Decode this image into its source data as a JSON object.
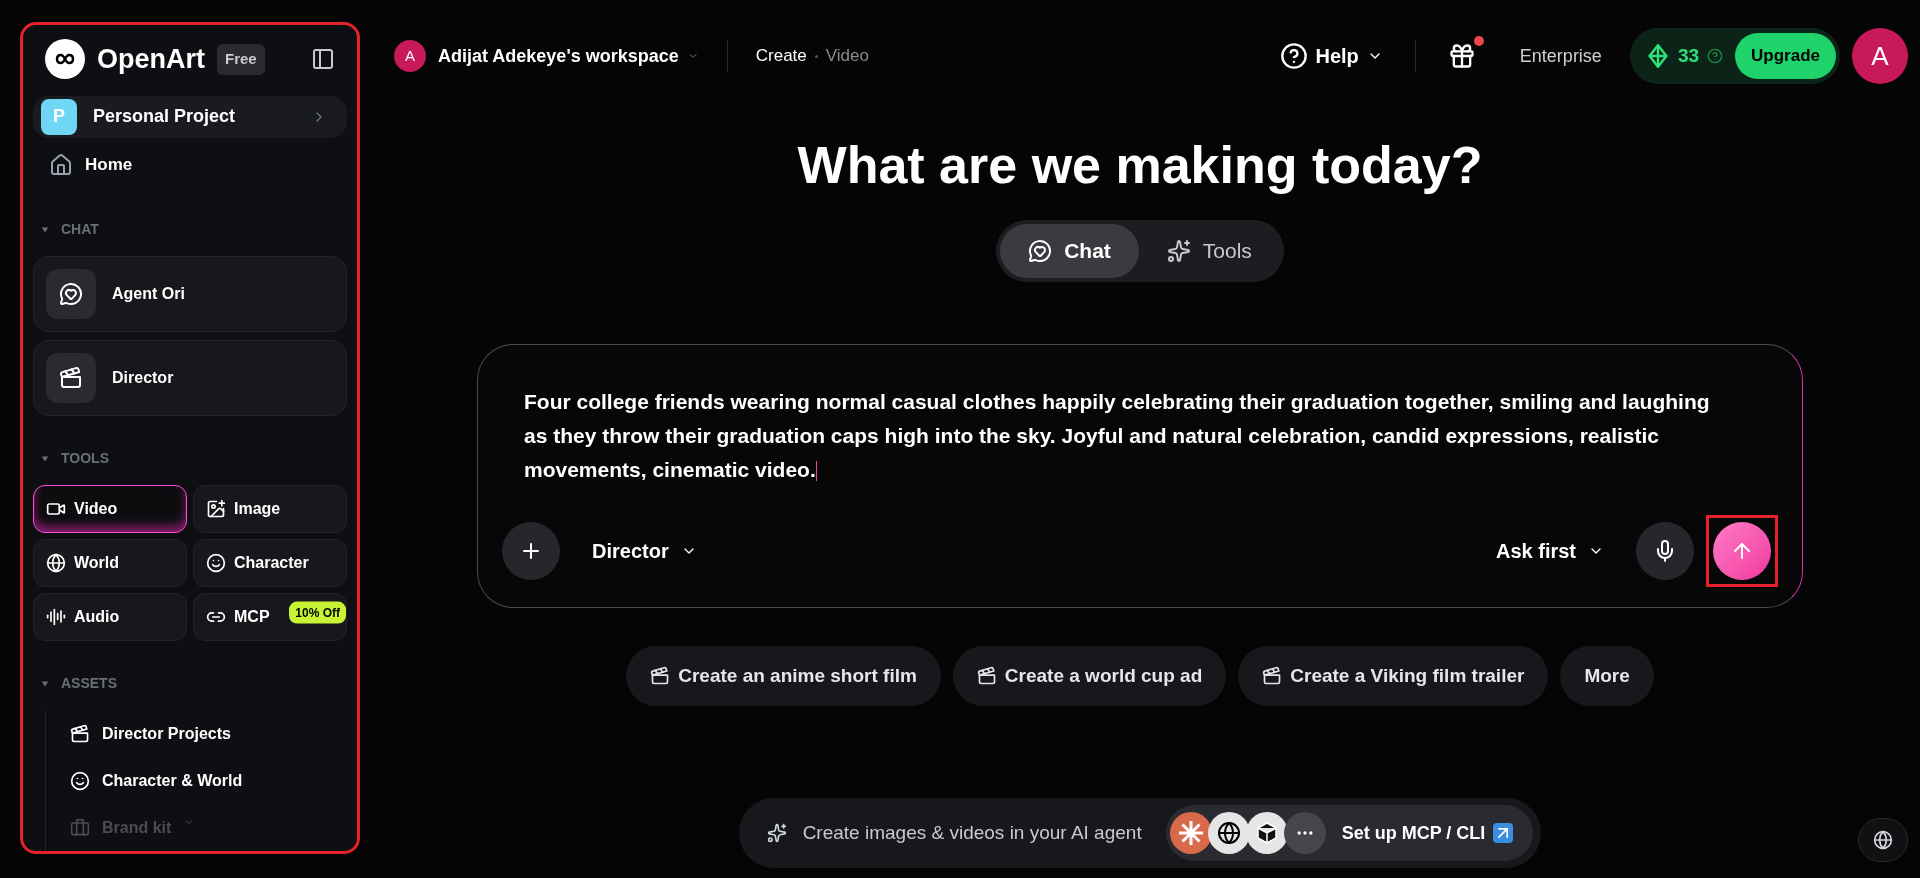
{
  "sidebar": {
    "highlighted": true,
    "brand": "OpenArt",
    "plan_badge": "Free",
    "project": {
      "initial": "P",
      "name": "Personal Project"
    },
    "home": "Home",
    "sections": [
      {
        "title": "CHAT",
        "expanded": true,
        "kind": "cards",
        "items": [
          {
            "label": "Agent Ori"
          },
          {
            "label": "Director"
          }
        ]
      },
      {
        "title": "TOOLS",
        "expanded": true,
        "kind": "grid",
        "items": [
          {
            "label": "Video",
            "selected": true
          },
          {
            "label": "Image",
            "selected": false
          },
          {
            "label": "World",
            "selected": false
          },
          {
            "label": "Character",
            "selected": false
          },
          {
            "label": "Audio",
            "selected": false
          },
          {
            "label": "MCP",
            "selected": false,
            "badge": "10% Off"
          }
        ]
      },
      {
        "title": "ASSETS",
        "expanded": true,
        "kind": "list",
        "items": [
          {
            "label": "Director Projects",
            "disabled": false
          },
          {
            "label": "Character & World",
            "disabled": false
          },
          {
            "label": "Brand kit",
            "disabled": true
          }
        ]
      }
    ]
  },
  "header": {
    "workspace_initial": "A",
    "workspace": "Adijat Adekeye's workspace",
    "breadcrumb": [
      "Create",
      "Video"
    ],
    "help": "Help",
    "gift_notification": true,
    "enterprise": "Enterprise",
    "credits": "33",
    "upgrade": "Upgrade",
    "avatar_initial": "A"
  },
  "title": "What are we making today?",
  "mode_tabs": [
    {
      "label": "Chat",
      "selected": true
    },
    {
      "label": "Tools",
      "selected": false
    }
  ],
  "composer": {
    "value": "Four college friends wearing normal casual clothes happily celebrating their graduation together, smiling and laughing as they throw their graduation caps high into the sky. Joyful and natural celebration, candid expressions, realistic movements, cinematic video.",
    "agent": "Director",
    "mode": "Ask first",
    "send_highlighted": true
  },
  "suggestions": [
    {
      "label": "Create an anime short film",
      "kind": "prompt"
    },
    {
      "label": "Create a world cup ad",
      "kind": "prompt"
    },
    {
      "label": "Create a Viking film trailer",
      "kind": "prompt"
    },
    {
      "label": "More",
      "kind": "more"
    }
  ],
  "agent_bar": {
    "text": "Create images & videos in your AI agent",
    "setup": "Set up MCP / CLI"
  }
}
